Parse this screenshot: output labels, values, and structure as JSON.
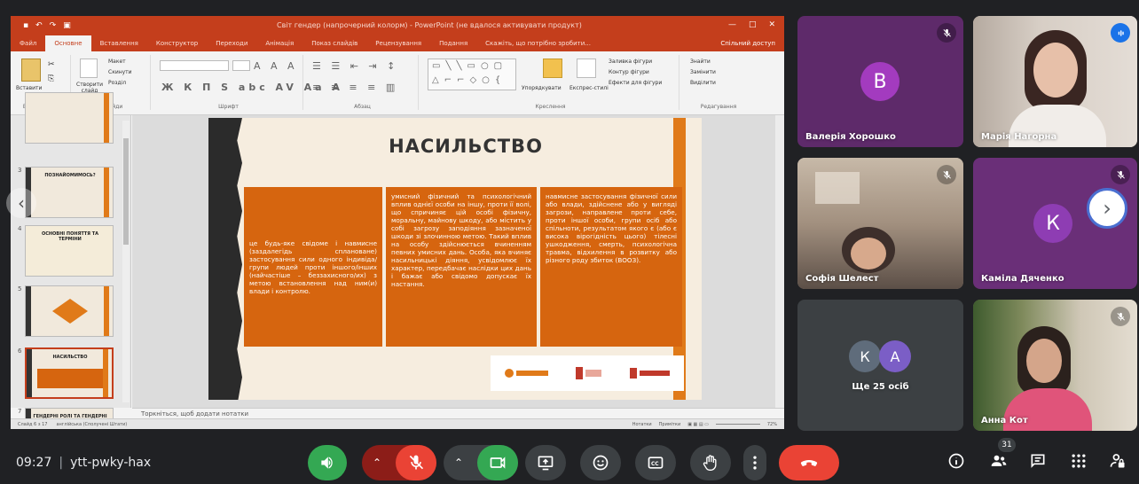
{
  "meeting": {
    "time": "09:27",
    "code": "ytt-pwky-hax",
    "participant_count": "31"
  },
  "ppt": {
    "document_title": "Світ гендер (напрочерний колорм) - PowerPoint (не вдалося активувати продукт)",
    "tabs": [
      "Файл",
      "Основне",
      "Вставлення",
      "Конструктор",
      "Переходи",
      "Анімація",
      "Показ слайдів",
      "Рецензування",
      "Подання"
    ],
    "tell_me": "Скажіть, що потрібно зробити...",
    "share": "Спільний доступ",
    "ribbon": {
      "paste": "Вставити",
      "layout": "Макет",
      "reset": "Скинути",
      "new_slide": "Створити слайд",
      "section": "Розділ",
      "clipboard_group": "Буфер обміну",
      "slides_group": "Слайди",
      "font_group": "Шрифт",
      "paragraph_group": "Абзац",
      "drawing_group": "Креслення",
      "editing_group": "Редагування",
      "arrange": "Упорядкувати",
      "quick_styles": "Експрес-стилі",
      "shape_fill": "Заливка фігури",
      "shape_outline": "Контур фігури",
      "shape_effects": "Ефекти для фігури",
      "find": "Знайти",
      "replace": "Замінити",
      "select": "Виділити",
      "font_glyphs": "Ж К П S abc AV Aa A"
    },
    "thumbnails": [
      {
        "num": "",
        "caption": ""
      },
      {
        "num": "3",
        "caption": "ПОЗНАЙОМИМОСЬ?"
      },
      {
        "num": "4",
        "caption": "ОСНОВНІ ПОНЯТТЯ ТА ТЕРМІНИ"
      },
      {
        "num": "5",
        "caption": ""
      },
      {
        "num": "6",
        "caption": "НАСИЛЬСТВО"
      },
      {
        "num": "7",
        "caption": "ГЕНДЕРНІ РОЛІ ТА ГЕНДЕРНІ СТЕРЕОТИПИ"
      }
    ],
    "slide": {
      "title": "НАСИЛЬСТВО",
      "box1": "це будь-яке свідоме і навмисне (заздалегідь сплановане) застосування сили одного індивіда/групи людей проти іншого/інших (найчастіше – беззахисного/их) з метою встановлення над ним(и) влади і контролю.",
      "box2": "умисний фізичний та психологічний вплив однієї особи на іншу, проти її волі, що спричиняє цій особі фізичну, моральну, майнову шкоду, або містить у собі загрозу заподіяння зазначеної шкоди зі злочинною метою. Такий вплив на особу здійснюється вчиненням певних умисних дань. Особа, яка вчиняє насильницькі діяння, усвідомлює їх характер, передбачає наслідки цих дань і бажає або свідомо допускає їх настання.",
      "box3": "навмисне застосування фізичної сили або влади, здійснене або у вигляді загрози, направлене проти себе, проти іншої особи, групи осіб або спільноти, результатом якого є (або є висока вірогідність цього) тілесні ушкодження, смерть, психологічна травма, відхилення в розвитку або різного роду збиток (ВООЗ)."
    },
    "notes_placeholder": "Торкніться, щоб додати нотатки",
    "status": {
      "slide": "Слайд 6 з 17",
      "language": "англійська (Сполучені Штати)",
      "notes": "Нотатки",
      "comments": "Примітки",
      "zoom": "72%"
    }
  },
  "participants": [
    {
      "name": "Валерія Хорошко",
      "initial": "В",
      "avatar_color": "#1e88e5",
      "bg": "#5e2a6a",
      "muted": true
    },
    {
      "name": "Марія Нагорна",
      "initial": "",
      "avatar_color": "",
      "bg": "#b8a9a0",
      "muted": false
    },
    {
      "name": "Софія Шелест",
      "initial": "",
      "avatar_color": "",
      "bg": "#8a7d76",
      "muted": true
    },
    {
      "name": "Каміла Дяченко",
      "initial": "К",
      "avatar_color": "#8e24aa",
      "bg": "#6a2f78",
      "muted": true
    },
    {
      "name": "Ще 25 осіб",
      "initials": [
        "К",
        "А"
      ],
      "avatar_colors": [
        "#5f6c7b",
        "#7b5ec6"
      ],
      "bg": "#3c4043"
    },
    {
      "name": "Анна Кот",
      "initial": "",
      "avatar_color": "",
      "bg": "#6d6456",
      "muted": true
    }
  ],
  "colors": {
    "accent_orange": "#d6650f",
    "ppt_red": "#c43e1c",
    "end_call": "#ea4335",
    "mic_off": "#ea4335",
    "camera_on": "#34a853"
  },
  "controls": {
    "mic": "volume-icon",
    "mic_toggle": "mic-off-icon",
    "camera": "camera-icon",
    "present": "present-icon",
    "emoji": "emoji-icon",
    "captions": "captions-icon",
    "raise_hand": "hand-icon",
    "more": "more-vert-icon",
    "end_call": "end-call-icon",
    "info": "info-icon",
    "people": "people-icon",
    "chat": "chat-icon",
    "activities": "apps-icon",
    "host_controls": "lock-person-icon"
  }
}
